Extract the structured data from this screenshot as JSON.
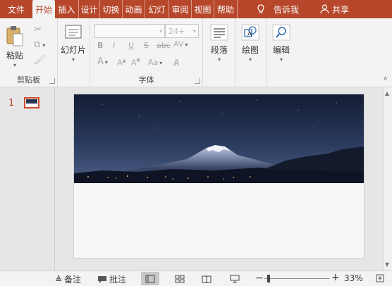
{
  "tabs": [
    {
      "label": "文件",
      "active": false
    },
    {
      "label": "开始",
      "active": true
    },
    {
      "label": "插入",
      "active": false
    },
    {
      "label": "设计",
      "active": false
    },
    {
      "label": "切换",
      "active": false
    },
    {
      "label": "动画",
      "active": false
    },
    {
      "label": "幻灯",
      "active": false
    },
    {
      "label": "审阅",
      "active": false
    },
    {
      "label": "视图",
      "active": false
    },
    {
      "label": "帮助",
      "active": false
    }
  ],
  "tell_me": {
    "label": "告诉我",
    "icon": "lightbulb-icon"
  },
  "share": {
    "label": "共享",
    "icon": "person-icon"
  },
  "ribbon": {
    "clipboard": {
      "group_label": "剪贴板",
      "paste_label": "粘贴"
    },
    "slides": {
      "new_slide_label": "幻灯片"
    },
    "font": {
      "group_label": "字体",
      "font_name": "",
      "font_size": "24+",
      "bold": "B",
      "italic": "I",
      "underline": "U",
      "strike": "S",
      "abc": "abc",
      "spacing": "AV",
      "color": "A",
      "case": "Aa"
    },
    "paragraph": {
      "label": "段落"
    },
    "drawing": {
      "label": "绘图"
    },
    "editing": {
      "label": "编辑"
    }
  },
  "slide_pane": {
    "slide_number": "1"
  },
  "status": {
    "notes_label": "备注",
    "comments_label": "批注",
    "zoom_percent": "33%",
    "zoom_minus": "−",
    "zoom_plus": "+"
  },
  "colors": {
    "accent": "#b7472a",
    "ribbon_bg": "#f3f3f3",
    "canvas_bg": "#e6e6e6"
  }
}
